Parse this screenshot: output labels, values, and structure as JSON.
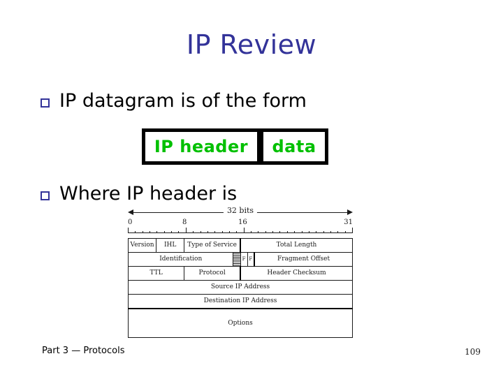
{
  "slide": {
    "title": "IP Review",
    "title_color": "#333399",
    "background": "#ffffff"
  },
  "bullets": [
    {
      "marker": "square-outline-bullet",
      "text": "IP datagram is of the form"
    },
    {
      "marker": "square-outline-bullet",
      "text": "Where IP header is"
    }
  ],
  "datagram": {
    "accent_color": "#00C000",
    "boxes": [
      {
        "label": "IP header"
      },
      {
        "label": "data"
      }
    ]
  },
  "ip_header_figure": {
    "width_label": "32 bits",
    "ruler_ticks": [
      "0",
      "8",
      "16",
      "31"
    ],
    "rows": [
      {
        "name": "row-1",
        "cells": [
          {
            "label": "Version",
            "bits": 4
          },
          {
            "label": "IHL",
            "bits": 4
          },
          {
            "label": "Type of Service",
            "bits": 8
          },
          {
            "label": "Total Length",
            "bits": 16
          }
        ]
      },
      {
        "name": "row-2",
        "cells": [
          {
            "label": "Identification",
            "bits": 15
          },
          {
            "label": "",
            "bits": 1,
            "style": "hatched"
          },
          {
            "label": "F",
            "bits": 1
          },
          {
            "label": "F",
            "bits": 1
          },
          {
            "label": "Fragment Offset",
            "bits": 13
          }
        ]
      },
      {
        "name": "row-3",
        "cells": [
          {
            "label": "TTL",
            "bits": 8
          },
          {
            "label": "Protocol",
            "bits": 8
          },
          {
            "label": "Header Checksum",
            "bits": 16
          }
        ]
      },
      {
        "name": "row-4",
        "cells": [
          {
            "label": "Source IP Address",
            "bits": 32
          }
        ]
      },
      {
        "name": "row-5",
        "cells": [
          {
            "label": "Destination IP Address",
            "bits": 32
          }
        ]
      },
      {
        "name": "row-6",
        "cells": [
          {
            "label": "Options",
            "bits": 32
          }
        ]
      }
    ]
  },
  "footer": {
    "left": "Part 3 — Protocols",
    "page_number": "109"
  }
}
